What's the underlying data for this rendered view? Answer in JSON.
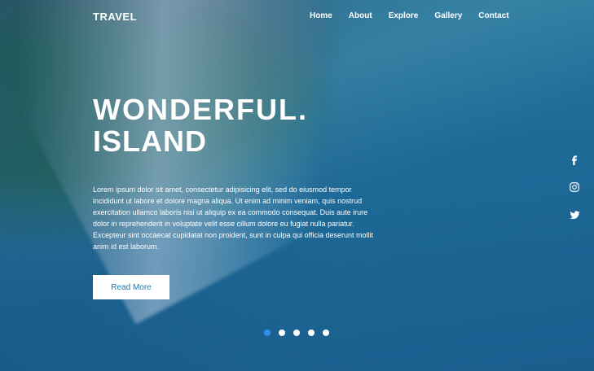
{
  "nav": {
    "brand": "TRAVEL",
    "items": [
      {
        "label": "Home"
      },
      {
        "label": "About"
      },
      {
        "label": "Explore"
      },
      {
        "label": "Gallery"
      },
      {
        "label": "Contact"
      }
    ]
  },
  "hero": {
    "title_line1": "WONDERFUL.",
    "title_line2": "ISLAND",
    "description": "Lorem ipsum dolor sit amet, consectetur adipisicing elit, sed do eiusmod tempor incididunt ut labore et dolore magna aliqua. Ut enim ad minim veniam, quis nostrud exercitation ullamco laboris nisi ut aliquip ex ea commodo consequat. Duis aute irure dolor in reprehenderit in voluptate velit esse cillum dolore eu fugiat nulla pariatur. Excepteur sint occaecat cupidatat non proident, sunt in culpa qui officia deserunt mollit anim id est laborum.",
    "button_label": "Read More"
  },
  "social": {
    "icons": [
      "facebook-icon",
      "instagram-icon",
      "twitter-icon"
    ]
  },
  "slider": {
    "slide_count": 5,
    "active_index": 0
  },
  "colors": {
    "accent": "#2d8ee8",
    "button_text": "#1d79a6"
  }
}
